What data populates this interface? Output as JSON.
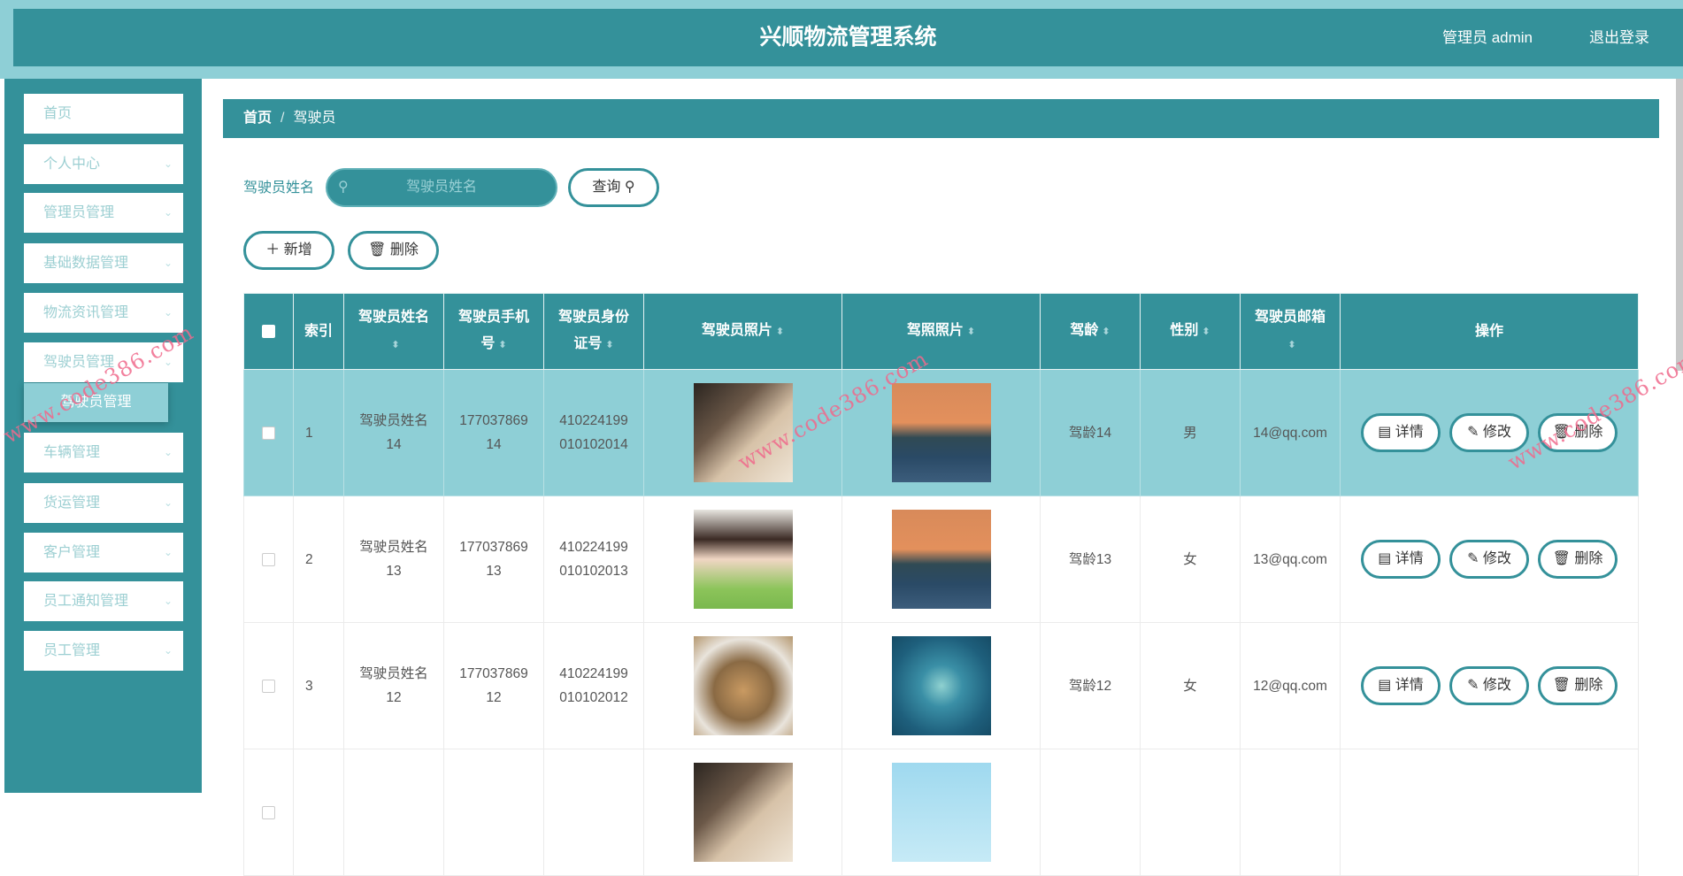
{
  "header": {
    "title": "兴顺物流管理系统",
    "user": "管理员 admin",
    "logout": "退出登录"
  },
  "sidebar": {
    "items": [
      {
        "label": "首页",
        "chev": false
      },
      {
        "label": "个人中心",
        "chev": true
      },
      {
        "label": "管理员管理",
        "chev": true
      },
      {
        "label": "基础数据管理",
        "chev": true
      },
      {
        "label": "物流资讯管理",
        "chev": true
      },
      {
        "label": "驾驶员管理",
        "chev": true
      },
      {
        "label": "车辆管理",
        "chev": true
      },
      {
        "label": "货运管理",
        "chev": true
      },
      {
        "label": "客户管理",
        "chev": true
      },
      {
        "label": "员工通知管理",
        "chev": true
      },
      {
        "label": "员工管理",
        "chev": true
      }
    ],
    "active_sub": "驾驶员管理"
  },
  "breadcrumb": {
    "home": "首页",
    "sep": "/",
    "current": "驾驶员"
  },
  "search": {
    "label": "驾驶员姓名",
    "placeholder": "驾驶员姓名",
    "query": "查询"
  },
  "actions": {
    "add": "新增",
    "delete": "删除"
  },
  "table": {
    "headers": [
      "索引",
      "驾驶员姓名",
      "驾驶员手机号",
      "驾驶员身份证号",
      "驾驶员照片",
      "驾照照片",
      "驾龄",
      "性别",
      "驾驶员邮箱",
      "操作"
    ],
    "ops": {
      "detail": "详情",
      "edit": "修改",
      "delete": "删除"
    },
    "rows": [
      {
        "index": "1",
        "name": "驾驶员姓名14",
        "phone": "17703786914",
        "idcard": "410224199010102014",
        "photo": "man",
        "license": "sunset",
        "age": "驾龄14",
        "gender": "男",
        "email": "14@qq.com"
      },
      {
        "index": "2",
        "name": "驾驶员姓名13",
        "phone": "17703786913",
        "idcard": "410224199010102013",
        "photo": "girl",
        "license": "sunset",
        "age": "驾龄13",
        "gender": "女",
        "email": "13@qq.com"
      },
      {
        "index": "3",
        "name": "驾驶员姓名12",
        "phone": "17703786912",
        "idcard": "410224199010102012",
        "photo": "cat",
        "license": "heart-island",
        "age": "驾龄12",
        "gender": "女",
        "email": "12@qq.com"
      },
      {
        "index": "",
        "name": "",
        "phone": "",
        "idcard": "",
        "photo": "man",
        "license": "sky",
        "age": "",
        "gender": "",
        "email": ""
      }
    ]
  },
  "watermark": "www.code386.com",
  "colors": {
    "primary": "#34919a",
    "light": "#8ecfd6"
  }
}
